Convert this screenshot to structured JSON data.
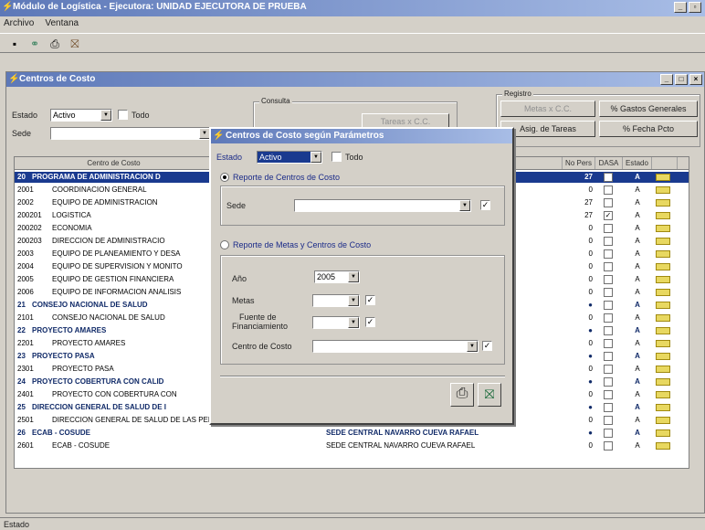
{
  "app": {
    "title": "Módulo de Logística - Ejecutora: UNIDAD EJECUTORA DE PRUEBA",
    "menu": [
      "Archivo",
      "Ventana"
    ],
    "toolbar_icons": [
      "save-icon",
      "binoculars-icon",
      "print-icon",
      "exit-door-icon"
    ]
  },
  "window": {
    "title": "Centros de Costo",
    "estado_label": "Estado",
    "estado_value": "Activo",
    "todo_label": "Todo",
    "sede_label": "Sede",
    "sede_value": "",
    "consulta_group": "Consulta",
    "consulta_button": "Tareas x C.C.",
    "registro_group": "Registro",
    "registro_buttons": [
      "Metas x C.C.",
      "% Gastos Generales",
      "Asig. de Tareas",
      "% Fecha Pcto"
    ]
  },
  "grid": {
    "headers": [
      "Centro de Costo",
      "",
      "",
      "No Pers",
      "DASA",
      "Estado",
      ""
    ],
    "rows": [
      {
        "code": "20",
        "name": "PROGRAMA DE ADMINISTRACION D",
        "resp": "",
        "pers": "27",
        "dasa": "",
        "estado": "A",
        "group": true,
        "selected": true
      },
      {
        "code": "2001",
        "name": "COORDINACION GENERAL",
        "resp": "",
        "pers": "0",
        "dasa": "",
        "estado": "A"
      },
      {
        "code": "2002",
        "name": "EQUIPO DE ADMINISTRACION",
        "resp": "BETH",
        "pers": "27",
        "dasa": "",
        "estado": "A"
      },
      {
        "code": "200201",
        "name": "LOGISTICA",
        "resp": "YS",
        "pers": "27",
        "dasa": "✓",
        "estado": "A"
      },
      {
        "code": "200202",
        "name": "ECONOMIA",
        "resp": "",
        "pers": "0",
        "dasa": "",
        "estado": "A"
      },
      {
        "code": "200203",
        "name": "DIRECCION DE ADMINISTRACIO",
        "resp": "BETH",
        "pers": "0",
        "dasa": "",
        "estado": "A"
      },
      {
        "code": "2003",
        "name": "EQUIPO DE PLANEAMIENTO Y DESA",
        "resp": "",
        "pers": "0",
        "dasa": "",
        "estado": "A"
      },
      {
        "code": "2004",
        "name": "EQUIPO DE SUPERVISION Y MONITO",
        "resp": "",
        "pers": "0",
        "dasa": "",
        "estado": "A"
      },
      {
        "code": "2005",
        "name": "EQUIPO DE GESTION FINANCIERA",
        "resp": "LA",
        "pers": "0",
        "dasa": "",
        "estado": "A"
      },
      {
        "code": "2006",
        "name": "EQUIPO DE INFORMACION ANALISIS",
        "resp": "",
        "pers": "0",
        "dasa": "",
        "estado": "A"
      },
      {
        "code": "21",
        "name": "CONSEJO NACIONAL DE SALUD",
        "resp": "RGE",
        "pers": "●",
        "dasa": "",
        "estado": "A",
        "group": true
      },
      {
        "code": "2101",
        "name": "CONSEJO NACIONAL DE SALUD",
        "resp": "E",
        "pers": "0",
        "dasa": "",
        "estado": "A"
      },
      {
        "code": "22",
        "name": "PROYECTO AMARES",
        "resp": "CESAR",
        "pers": "●",
        "dasa": "",
        "estado": "A",
        "group": true
      },
      {
        "code": "2201",
        "name": "PROYECTO AMARES",
        "resp": "",
        "pers": "0",
        "dasa": "",
        "estado": "A"
      },
      {
        "code": "23",
        "name": "PROYECTO PASA",
        "resp": "CESAR",
        "pers": "●",
        "dasa": "",
        "estado": "A",
        "group": true
      },
      {
        "code": "2301",
        "name": "PROYECTO PASA",
        "resp": "SAR",
        "pers": "0",
        "dasa": "",
        "estado": "A"
      },
      {
        "code": "24",
        "name": "PROYECTO COBERTURA CON CALID",
        "resp": "CESAR",
        "pers": "●",
        "dasa": "",
        "estado": "A",
        "group": true
      },
      {
        "code": "2401",
        "name": "PROYECTO CON COBERTURA CON",
        "resp": "ESAR",
        "pers": "0",
        "dasa": "",
        "estado": "A"
      },
      {
        "code": "25",
        "name": "DIRECCION GENERAL DE SALUD DE I",
        "resp": "LADYS",
        "pers": "●",
        "dasa": "",
        "estado": "A",
        "group": true
      },
      {
        "code": "2501",
        "name": "DIRECCION GENERAL DE SALUD DE LAS PERSONAS",
        "resp": "SEDE CENTRAL",
        "pers": "0",
        "dasa": "",
        "estado": "A"
      },
      {
        "code": "26",
        "name": "ECAB - COSUDE",
        "resp": "SEDE CENTRAL   NAVARRO CUEVA RAFAEL",
        "pers": "●",
        "dasa": "",
        "estado": "A",
        "group": true
      },
      {
        "code": "2601",
        "name": "ECAB - COSUDE",
        "resp": "SEDE CENTRAL   NAVARRO CUEVA RAFAEL",
        "pers": "0",
        "dasa": "",
        "estado": "A"
      }
    ]
  },
  "dialog": {
    "title": "Centros de Costo según Parámetros",
    "estado_label": "Estado",
    "estado_value": "Activo",
    "todo_label": "Todo",
    "radio1": "Reporte de Centros de Costo",
    "sede_label": "Sede",
    "radio2": "Reporte de Metas y Centros de Costo",
    "anio_label": "Año",
    "anio_value": "2005",
    "metas_label": "Metas",
    "fuente_label_1": "Fuente de",
    "fuente_label_2": "Financiamiento",
    "cc_label": "Centro de Costo",
    "sede_checked": "✓",
    "metas_checked": "✓",
    "fuente_checked": "✓",
    "cc_checked": "✓"
  },
  "status": {
    "text": "Estado"
  }
}
